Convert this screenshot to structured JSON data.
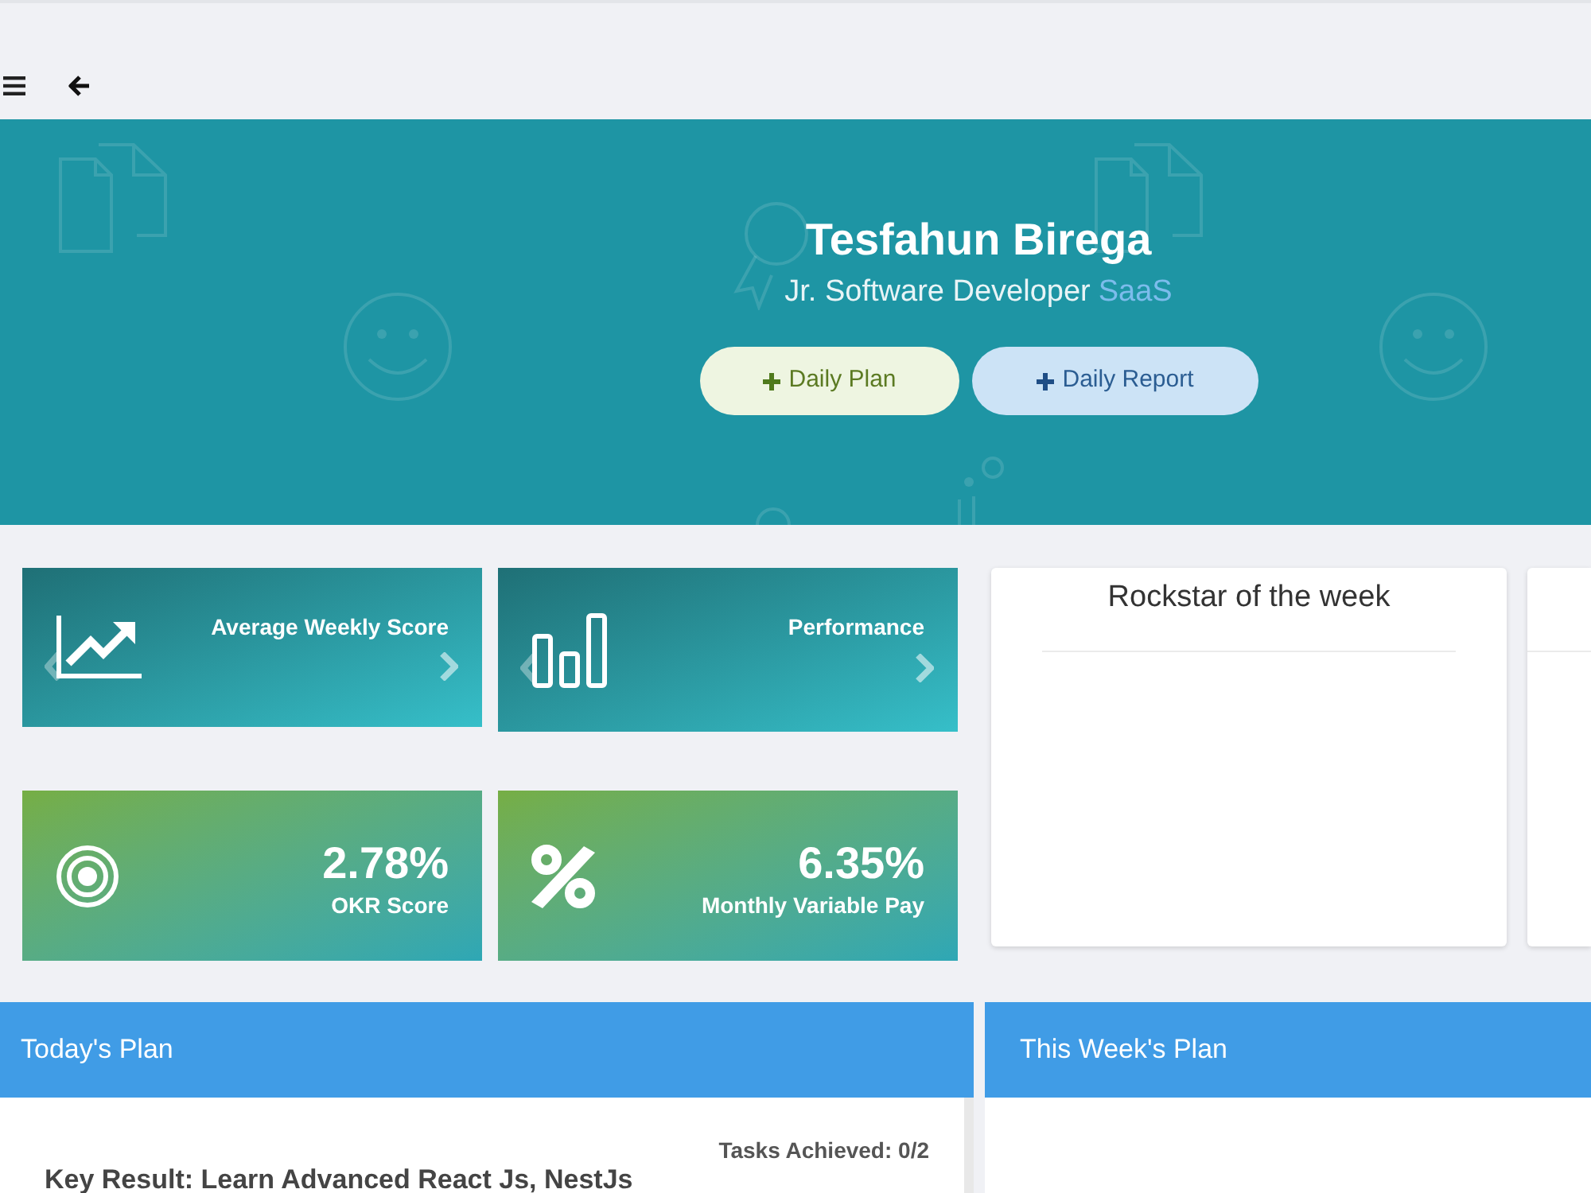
{
  "profile": {
    "name": "Tesfahun Birega",
    "role": "Jr. Software Developer",
    "team": "SaaS",
    "buttons": [
      {
        "label": "Daily Plan",
        "kind": "plan"
      },
      {
        "label": "Daily Report",
        "kind": "report"
      }
    ]
  },
  "stat_cards": [
    {
      "kind": "carousel",
      "label": "Average Weekly Score"
    },
    {
      "kind": "carousel",
      "label": "Performance"
    },
    {
      "kind": "metric",
      "value": "2.78%",
      "label": "OKR Score"
    },
    {
      "kind": "metric",
      "value": "6.35%",
      "label": "Monthly Variable Pay"
    }
  ],
  "rockstar": {
    "title": "Rockstar of the week"
  },
  "plans": [
    {
      "title": "Today's Plan",
      "tasks_achieved": "Tasks Achieved: 0/2",
      "key_result": "Key Result: Learn Advanced React Js, NestJs"
    },
    {
      "title": "This Week's Plan"
    }
  ]
}
